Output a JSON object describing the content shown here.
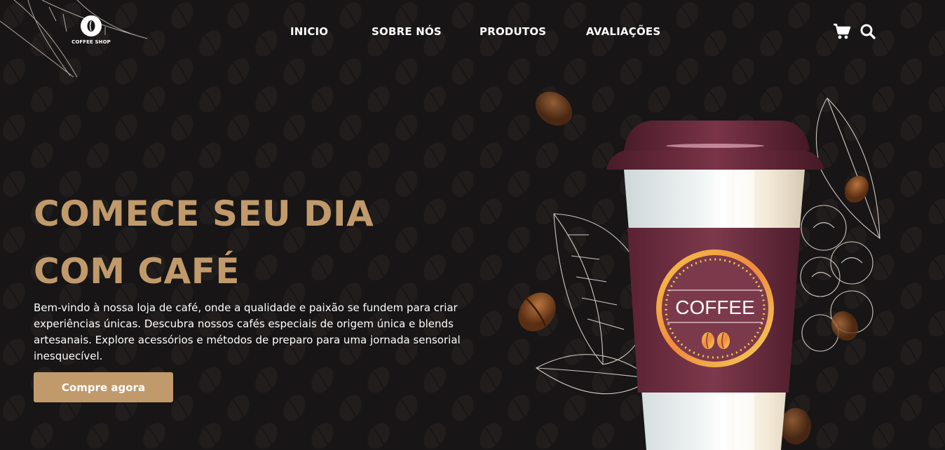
{
  "brand": {
    "logo_text": "COFFEE SHOP"
  },
  "nav": {
    "items": [
      {
        "label": "INICIO"
      },
      {
        "label": "SOBRE NÓS"
      },
      {
        "label": "PRODUTOS"
      },
      {
        "label": "AVALIAÇÕES"
      }
    ]
  },
  "icons": {
    "cart": "cart-icon",
    "search": "search-icon"
  },
  "hero": {
    "title_line1": "COMECE SEU DIA",
    "title_line2": "COM CAFÉ",
    "description": "Bem-vindo à nossa loja de café, onde a qualidade e paixão se fundem para criar experiências únicas. Descubra nossos cafés especiais de origem única e blends artesanais. Explore acessórios e métodos de preparo para uma jornada sensorial inesquecível.",
    "cta_label": "Compre agora"
  },
  "cup": {
    "label_text": "COFFEE"
  },
  "colors": {
    "background": "#171515",
    "accent": "#c19a6b",
    "cup_sleeve": "#6b2b3d",
    "cup_lid": "#5a2233",
    "badge_gold": "#f0b84a"
  }
}
